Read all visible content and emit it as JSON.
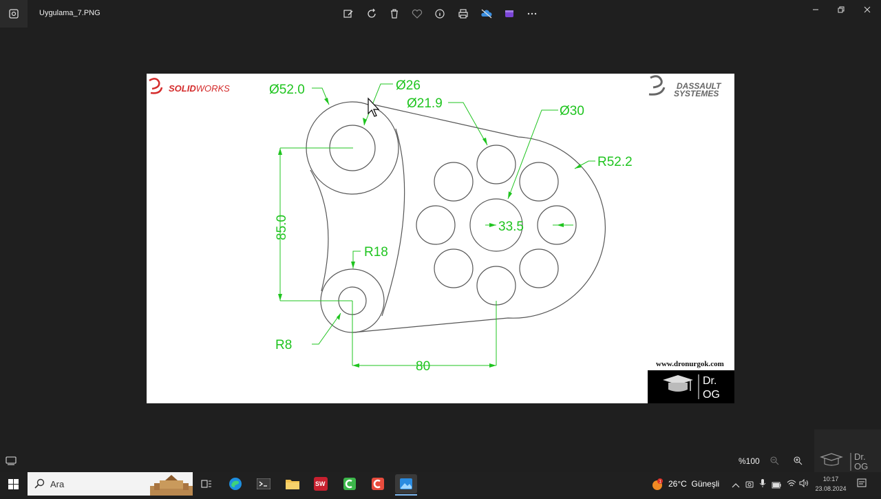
{
  "window": {
    "file_name": "Uygulama_7.PNG",
    "toolbar_icons": [
      "edit-image-icon",
      "rotate-icon",
      "delete-icon",
      "favorite-icon",
      "info-icon",
      "print-icon",
      "onedrive-off-icon",
      "clipchamp-icon",
      "more-icon"
    ],
    "controls": [
      "minimize-icon",
      "restore-icon",
      "close-icon"
    ]
  },
  "drawing": {
    "brand_left": {
      "prefix": "SOLID",
      "suffix": "WORKS"
    },
    "brand_right": {
      "line1": "DASSAULT",
      "line2": "SYSTEMES"
    },
    "dims": {
      "d52": "Ø52.0",
      "d26": "Ø26",
      "d219": "Ø21.9",
      "d30": "Ø30",
      "r522": "R52.2",
      "v85": "85.0",
      "v335": "33.5",
      "r18": "R18",
      "r8": "R8",
      "h80": "80"
    },
    "website": "www.dronurgok.com",
    "badge": {
      "line1": "Dr.",
      "line2": "OG"
    },
    "line_color": "#555555",
    "dim_color": "#1fc41f"
  },
  "statusbar": {
    "zoom": "%100"
  },
  "taskbar": {
    "search_placeholder": "Ara",
    "apps": [
      "task-view-icon",
      "edge-icon",
      "terminal-icon",
      "file-explorer-icon",
      "solidworks-icon",
      "camtasia-icon",
      "camtasia-rec-icon",
      "photos-icon"
    ],
    "weather": {
      "temp": "26°C",
      "condition": "Güneşli",
      "alert": "1"
    },
    "time": "10:17",
    "date": "23.08.2024"
  },
  "overlay_logo": {
    "line1": "Dr.",
    "line2": "OG"
  }
}
